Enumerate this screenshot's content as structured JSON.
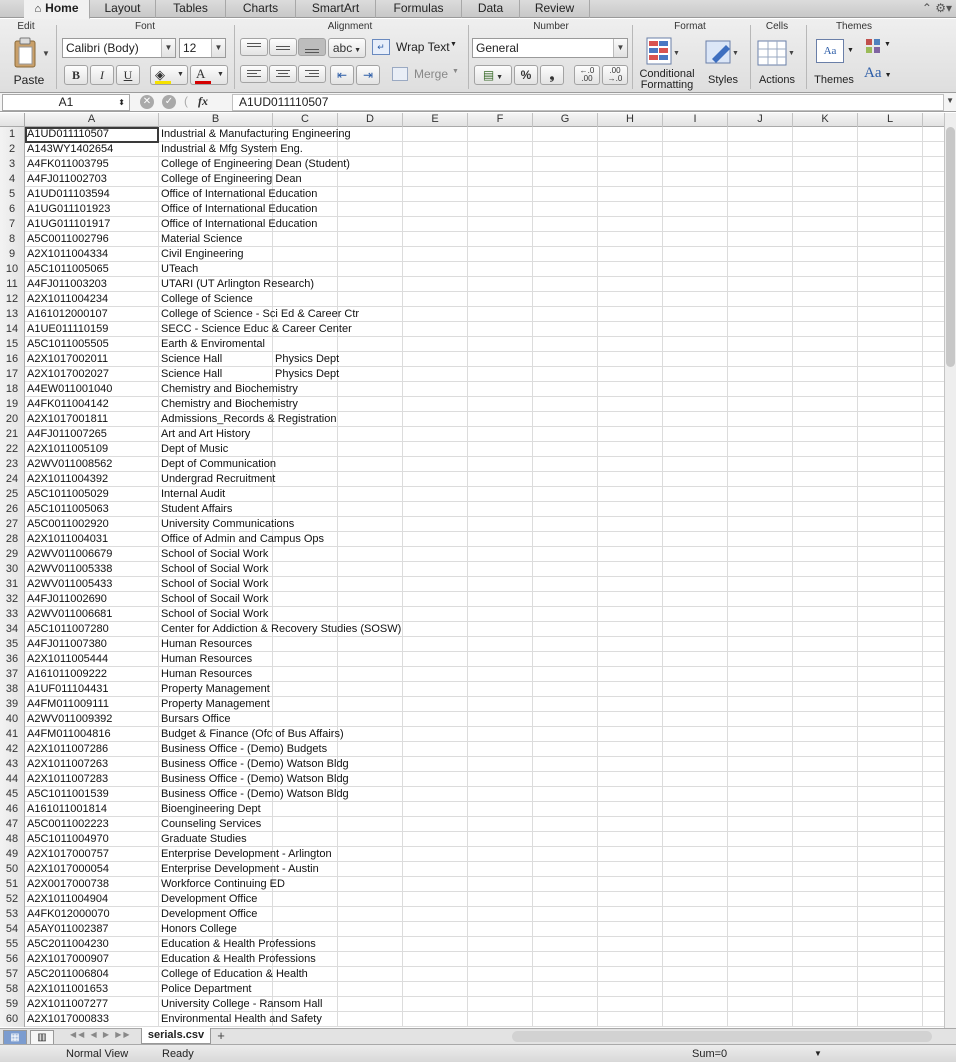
{
  "ribbon_tabs": [
    "Home",
    "Layout",
    "Tables",
    "Charts",
    "SmartArt",
    "Formulas",
    "Data",
    "Review"
  ],
  "window_controls": "⌃ ⚙▾",
  "groups": {
    "edit": "Edit",
    "font": "Font",
    "alignment": "Alignment",
    "number": "Number",
    "format": "Format",
    "cells": "Cells",
    "themes": "Themes"
  },
  "buttons": {
    "paste": "Paste",
    "bold": "B",
    "italic": "I",
    "underline": "U",
    "wrap_text": "Wrap Text",
    "merge": "Merge",
    "percent": "%",
    "comma": "❟",
    "abc": "abc",
    "conditional_formatting_1": "Conditional",
    "conditional_formatting_2": "Formatting",
    "styles": "Styles",
    "actions": "Actions",
    "themes": "Themes",
    "aa": "Aa"
  },
  "font": {
    "name": "Calibri (Body)",
    "size": "12"
  },
  "number_format": "General",
  "namebox": "A1",
  "fx": "fx",
  "formula": "A1UD011110507",
  "columns": [
    "A",
    "B",
    "C",
    "D",
    "E",
    "F",
    "G",
    "H",
    "I",
    "J",
    "K",
    "L"
  ],
  "rows": [
    [
      "1",
      "A1UD011110507",
      "Industrial & Manufacturing Engineering",
      ""
    ],
    [
      "2",
      "A143WY1402654",
      "Industrial & Mfg System Eng.",
      ""
    ],
    [
      "3",
      "A4FK011003795",
      "College of Engineering Dean (Student)",
      ""
    ],
    [
      "4",
      "A4FJ011002703",
      "College of Engineering Dean",
      ""
    ],
    [
      "5",
      "A1UD011103594",
      "Office of International Education",
      ""
    ],
    [
      "6",
      "A1UG011101923",
      "Office of International Education",
      ""
    ],
    [
      "7",
      "A1UG011101917",
      "Office of International Education",
      ""
    ],
    [
      "8",
      "A5C0011002796",
      "Material Science",
      ""
    ],
    [
      "9",
      "A2X1011004334",
      "Civil Engineering",
      ""
    ],
    [
      "10",
      "A5C1011005065",
      "UTeach",
      ""
    ],
    [
      "11",
      "A4FJ011003203",
      "UTARI (UT Arlington Research)",
      ""
    ],
    [
      "12",
      "A2X1011004234",
      "College of Science",
      ""
    ],
    [
      "13",
      "A161012000107",
      "College of Science - Sci Ed & Career Ctr",
      ""
    ],
    [
      "14",
      "A1UE011110159",
      "SECC - Science Educ & Career Center",
      ""
    ],
    [
      "15",
      "A5C1011005505",
      "Earth & Enviromental",
      ""
    ],
    [
      "16",
      "A2X1017002011",
      "Science Hall",
      "Physics Dept"
    ],
    [
      "17",
      "A2X1017002027",
      "Science Hall",
      "Physics Dept"
    ],
    [
      "18",
      "A4EW011001040",
      "Chemistry and Biochemistry",
      ""
    ],
    [
      "19",
      "A4FK011004142",
      "Chemistry and Biochemistry",
      ""
    ],
    [
      "20",
      "A2X1017001811",
      "Admissions_Records & Registration",
      ""
    ],
    [
      "21",
      "A4FJ011007265",
      "Art and Art History",
      ""
    ],
    [
      "22",
      "A2X1011005109",
      "Dept of Music",
      ""
    ],
    [
      "23",
      "A2WV011008562",
      "Dept of  Communication",
      ""
    ],
    [
      "24",
      "A2X1011004392",
      "Undergrad Recruitment",
      ""
    ],
    [
      "25",
      "A5C1011005029",
      "Internal Audit",
      ""
    ],
    [
      "26",
      "A5C1011005063",
      "Student Affairs",
      ""
    ],
    [
      "27",
      "A5C0011002920",
      "University Communications",
      ""
    ],
    [
      "28",
      "A2X1011004031",
      "Office of Admin and Campus Ops",
      ""
    ],
    [
      "29",
      "A2WV011006679",
      "School of Social Work",
      ""
    ],
    [
      "30",
      "A2WV011005338",
      "School of Social Work",
      ""
    ],
    [
      "31",
      "A2WV011005433",
      "School of Social Work",
      ""
    ],
    [
      "32",
      "A4FJ011002690",
      "School of Socail Work",
      ""
    ],
    [
      "33",
      "A2WV011006681",
      "School of Social Work",
      ""
    ],
    [
      "34",
      "A5C1011007280",
      "Center for Addiction & Recovery Studies (SOSW)",
      ""
    ],
    [
      "35",
      "A4FJ011007380",
      "Human Resources",
      ""
    ],
    [
      "36",
      "A2X1011005444",
      "Human Resources",
      ""
    ],
    [
      "37",
      "A161011009222",
      "Human Resources",
      ""
    ],
    [
      "38",
      "A1UF011104431",
      "Property Management",
      ""
    ],
    [
      "39",
      "A4FM011009111",
      "Property Management",
      ""
    ],
    [
      "40",
      "A2WV011009392",
      "Bursars Office",
      ""
    ],
    [
      "41",
      "A4FM011004816",
      "Budget & Finance (Ofc of Bus Affairs)",
      ""
    ],
    [
      "42",
      "A2X1011007286",
      "Business Office - (Demo) Budgets",
      ""
    ],
    [
      "43",
      "A2X1011007263",
      "Business Office - (Demo) Watson Bldg",
      ""
    ],
    [
      "44",
      "A2X1011007283",
      "Business Office - (Demo) Watson Bldg",
      ""
    ],
    [
      "45",
      "A5C1011001539",
      "Business Office - (Demo) Watson Bldg",
      ""
    ],
    [
      "46",
      "A161011001814",
      "Bioengineering Dept",
      ""
    ],
    [
      "47",
      "A5C0011002223",
      "Counseling Services",
      ""
    ],
    [
      "48",
      "A5C1011004970",
      "Graduate Studies",
      ""
    ],
    [
      "49",
      "A2X1017000757",
      "Enterprise Development - Arlington",
      ""
    ],
    [
      "50",
      "A2X1017000054",
      "Enterprise Development - Austin",
      ""
    ],
    [
      "51",
      "A2X0017000738",
      "Workforce Continuing ED",
      ""
    ],
    [
      "52",
      "A2X1011004904",
      "Development Office",
      ""
    ],
    [
      "53",
      "A4FK012000070",
      "Development Office",
      ""
    ],
    [
      "54",
      "A5AY011002387",
      "Honors College",
      ""
    ],
    [
      "55",
      "A5C2011004230",
      "Education & Health Professions",
      ""
    ],
    [
      "56",
      "A2X1017000907",
      "Education & Health Professions",
      ""
    ],
    [
      "57",
      "A5C2011006804",
      "College of Education & Health",
      ""
    ],
    [
      "58",
      "A2X1011001653",
      "Police Department",
      ""
    ],
    [
      "59",
      "A2X1011007277",
      "University College - Ransom Hall",
      ""
    ],
    [
      "60",
      "A2X1017000833",
      "Environmental Health and Safety",
      ""
    ]
  ],
  "sheet_tab": "serials.csv",
  "add_sheet": "+",
  "status": {
    "view": "Normal View",
    "state": "Ready",
    "sum": "Sum=0"
  }
}
